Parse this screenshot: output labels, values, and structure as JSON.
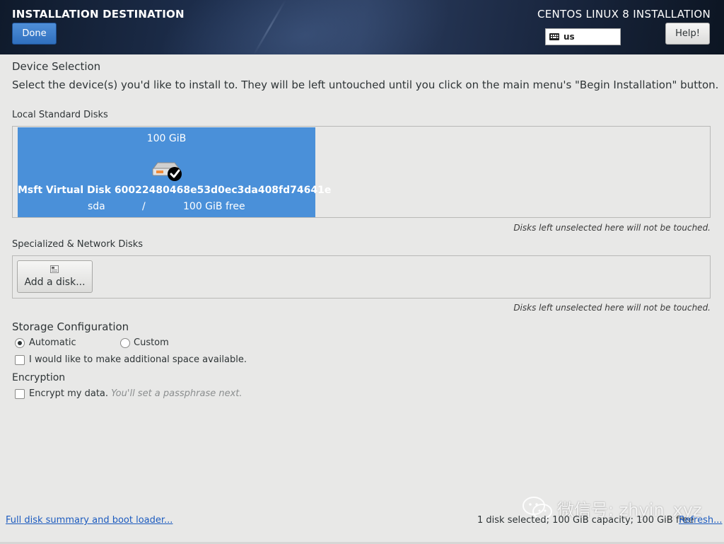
{
  "header": {
    "title": "INSTALLATION DESTINATION",
    "done_label": "Done",
    "product": "CENTOS LINUX 8 INSTALLATION",
    "keyboard_layout": "us",
    "help_label": "Help!"
  },
  "device_selection": {
    "heading": "Device Selection",
    "description": "Select the device(s) you'd like to install to.  They will be left untouched until you click on the main menu's \"Begin Installation\" button."
  },
  "local_disks": {
    "label": "Local Standard Disks",
    "disks": [
      {
        "size": "100 GiB",
        "name": "Msft Virtual Disk 60022480468e53d0ec3da408fd74641e",
        "device": "sda",
        "separator": "/",
        "free": "100 GiB free",
        "selected": true
      }
    ],
    "note": "Disks left unselected here will not be touched."
  },
  "specialized_disks": {
    "label": "Specialized & Network Disks",
    "add_disk_label": "Add a disk...",
    "note": "Disks left unselected here will not be touched."
  },
  "storage_config": {
    "heading": "Storage Configuration",
    "options": [
      {
        "label": "Automatic",
        "checked": true
      },
      {
        "label": "Custom",
        "checked": false
      }
    ],
    "additional_space_label": "I would like to make additional space available."
  },
  "encryption": {
    "heading": "Encryption",
    "encrypt_label": "Encrypt my data.",
    "encrypt_hint": "You'll set a passphrase next."
  },
  "footer": {
    "summary_link": "Full disk summary and boot loader...",
    "status": "1 disk selected; 100 GiB capacity; 100 GiB free",
    "refresh_link": "Refresh..."
  },
  "watermark": {
    "text": "微信号: zhyin_xyz"
  },
  "colors": {
    "accent": "#4a90d9",
    "link": "#1c5bbf",
    "background": "#e8e8e7"
  }
}
